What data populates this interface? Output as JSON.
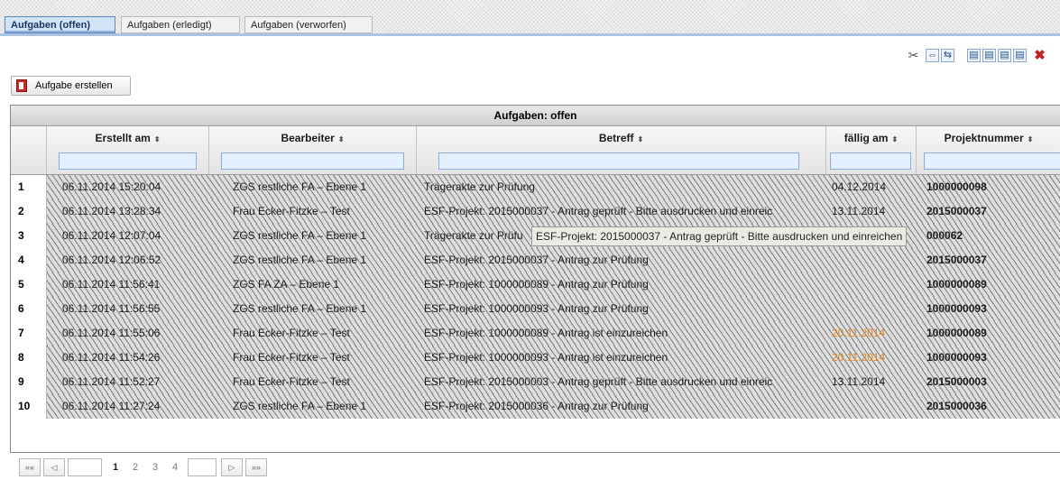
{
  "tabs": [
    {
      "label": "Aufgaben (offen)",
      "active": true
    },
    {
      "label": "Aufgaben (erledigt)",
      "active": false
    },
    {
      "label": "Aufgaben (verworfen)",
      "active": false
    }
  ],
  "toolbar": {
    "icons": [
      "tools-icon",
      "expand-columns-icon",
      "copy-icon",
      "export-icon",
      "print-icon",
      "settings-icon",
      "delete-icon"
    ]
  },
  "actions": {
    "create_task_label": "Aufgabe erstellen"
  },
  "grid": {
    "caption": "Aufgaben: offen",
    "columns": [
      {
        "label": "Erstellt am",
        "sort": "⬍"
      },
      {
        "label": "Bearbeiter",
        "sort": "⬍"
      },
      {
        "label": "Betreff",
        "sort": "⬍"
      },
      {
        "label": "fällig am",
        "sort": "⬍"
      },
      {
        "label": "Projektnummer",
        "sort": "⬍"
      }
    ],
    "rows": [
      {
        "n": "1",
        "created": "06.11.2014 15:20:04",
        "assignee": "ZGS restliche FA – Ebene 1",
        "subject": "Trägerakte zur Prüfung",
        "due": "04.12.2014",
        "due_status": "normal",
        "project": "1000000098"
      },
      {
        "n": "2",
        "created": "06.11.2014 13:28:34",
        "assignee": "Frau Ecker-Fitzke – Test",
        "subject": "ESF-Projekt: 2015000037 - Antrag geprüft - Bitte ausdrucken und einreic",
        "due": "13.11.2014",
        "due_status": "normal",
        "project": "2015000037"
      },
      {
        "n": "3",
        "created": "06.11.2014 12:07:04",
        "assignee": "ZGS restliche FA – Ebene 1",
        "subject": "Trägerakte zur Prüfu",
        "due": "",
        "due_status": "normal",
        "project": "000062"
      },
      {
        "n": "4",
        "created": "06.11.2014 12:06:52",
        "assignee": "ZGS restliche FA – Ebene 1",
        "subject": "ESF-Projekt: 2015000037 - Antrag zur Prüfung",
        "due": "",
        "due_status": "normal",
        "project": "2015000037"
      },
      {
        "n": "5",
        "created": "06.11.2014 11:56:41",
        "assignee": "ZGS FA ZA – Ebene 1",
        "subject": "ESF-Projekt: 1000000089 - Antrag zur Prüfung",
        "due": "",
        "due_status": "normal",
        "project": "1000000089"
      },
      {
        "n": "6",
        "created": "06.11.2014 11:56:55",
        "assignee": "ZGS restliche FA – Ebene 1",
        "subject": "ESF-Projekt: 1000000093 - Antrag zur Prüfung",
        "due": "",
        "due_status": "normal",
        "project": "1000000093"
      },
      {
        "n": "7",
        "created": "06.11.2014 11:55:06",
        "assignee": "Frau Ecker-Fitzke – Test",
        "subject": "ESF-Projekt: 1000000089 - Antrag ist einzureichen",
        "due": "20.11.2014",
        "due_status": "late",
        "project": "1000000089"
      },
      {
        "n": "8",
        "created": "06.11.2014 11:54:26",
        "assignee": "Frau Ecker-Fitzke – Test",
        "subject": "ESF-Projekt: 1000000093 - Antrag ist einzureichen",
        "due": "20.11.2014",
        "due_status": "late",
        "project": "1000000093"
      },
      {
        "n": "9",
        "created": "06.11.2014 11:52:27",
        "assignee": "Frau Ecker-Fitzke – Test",
        "subject": "ESF-Projekt: 2015000003 - Antrag geprüft - Bitte ausdrucken und einreic",
        "due": "13.11.2014",
        "due_status": "normal",
        "project": "2015000003"
      },
      {
        "n": "10",
        "created": "06.11.2014 11:27:24",
        "assignee": "ZGS restliche FA – Ebene 1",
        "subject": "ESF-Projekt: 2015000036 - Antrag zur Prüfung",
        "due": "",
        "due_status": "normal",
        "project": "2015000036"
      }
    ],
    "tooltip": {
      "row": 2,
      "text": "ESF-Projekt: 2015000037 - Antrag geprüft - Bitte ausdrucken und einreichen"
    }
  },
  "pager": {
    "first": "««",
    "prev": "◁",
    "pages": [
      "1",
      "2",
      "3",
      "4"
    ],
    "current": "1",
    "next": "▷",
    "last": "»»"
  },
  "colors": {
    "accent": "#5e86b8",
    "filter_bg": "#e4efff",
    "late": "#e0861e",
    "delete": "#c42121"
  }
}
